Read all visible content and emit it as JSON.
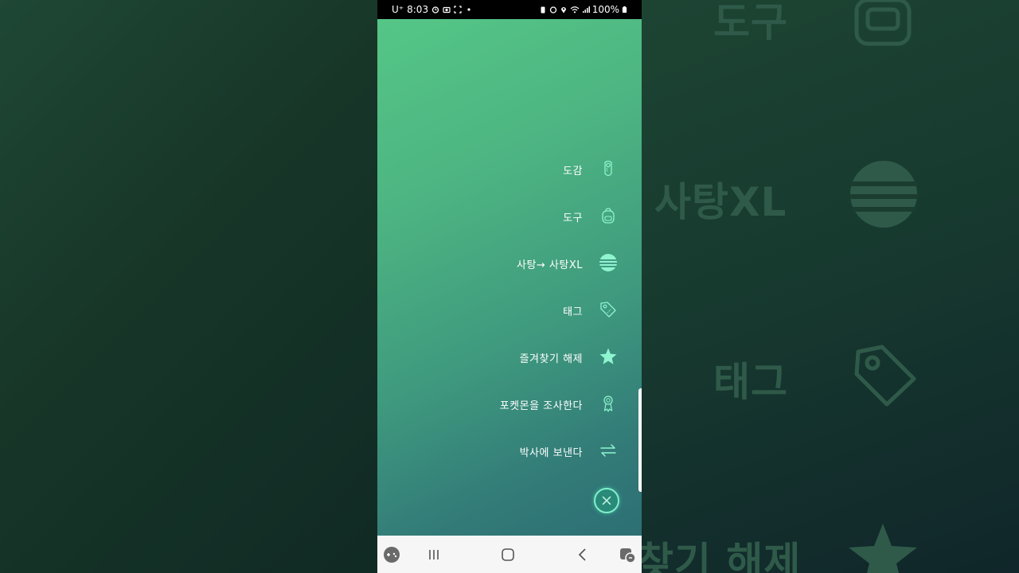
{
  "status_bar": {
    "carrier": "U⁺",
    "time": "8:03",
    "battery": "100%"
  },
  "menu": {
    "items": [
      {
        "label": "도감",
        "icon": "pokedex-icon"
      },
      {
        "label": "도구",
        "icon": "backpack-icon"
      },
      {
        "label": "사탕→ 사탕XL",
        "icon": "candy-icon"
      },
      {
        "label": "태그",
        "icon": "tag-icon"
      },
      {
        "label": "즐겨찾기 해제",
        "icon": "star-icon"
      },
      {
        "label": "포켓몬을 조사한다",
        "icon": "appraise-icon"
      },
      {
        "label": "박사에 보낸다",
        "icon": "transfer-icon"
      }
    ],
    "close_icon": "close-icon"
  },
  "background": {
    "labels": [
      "도구",
      "사탕XL",
      "태그",
      "찾기 해제"
    ]
  },
  "nav_bar": {
    "icons": [
      "game-tools-icon",
      "recent-apps-icon",
      "home-icon",
      "back-icon",
      "game-booster-icon"
    ]
  },
  "colors": {
    "accent": "#7ff0c8",
    "gradient_top": "#55c686",
    "gradient_bottom": "#2d6f74"
  }
}
